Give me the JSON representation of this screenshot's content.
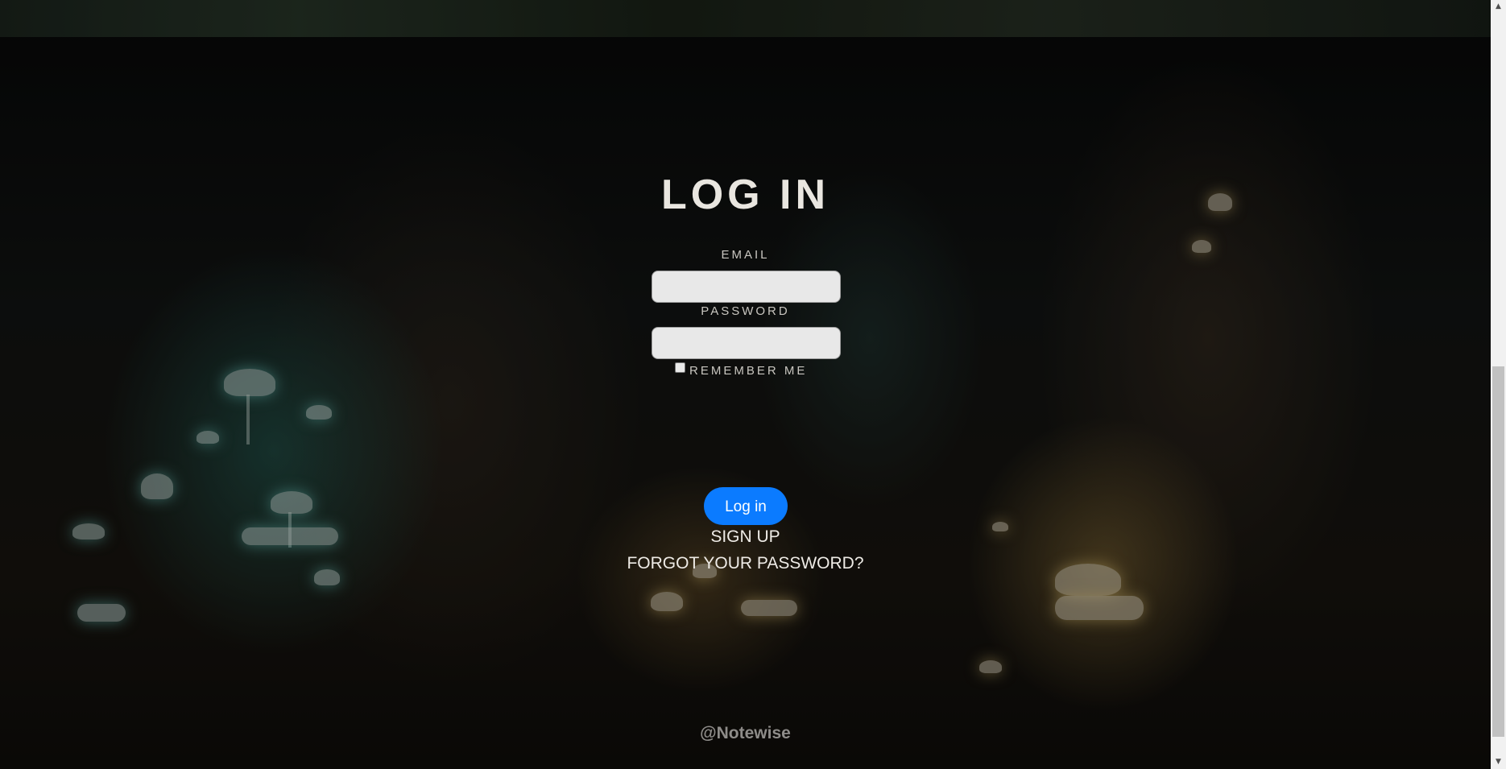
{
  "login": {
    "title": "LOG IN",
    "email_label": "EMAIL",
    "email_value": "",
    "password_label": "PASSWORD",
    "password_value": "",
    "remember_label": "REMEMBER ME",
    "remember_checked": false,
    "login_button": "Log in",
    "signup_link": "SIGN UP",
    "forgot_link": "FORGOT YOUR PASSWORD?"
  },
  "footer": {
    "credit": "@Notewise"
  },
  "colors": {
    "accent": "#0b7bff",
    "title_text": "#e9e6e0"
  },
  "icons": {
    "scroll_up": "triangle-up",
    "scroll_down": "triangle-down"
  }
}
